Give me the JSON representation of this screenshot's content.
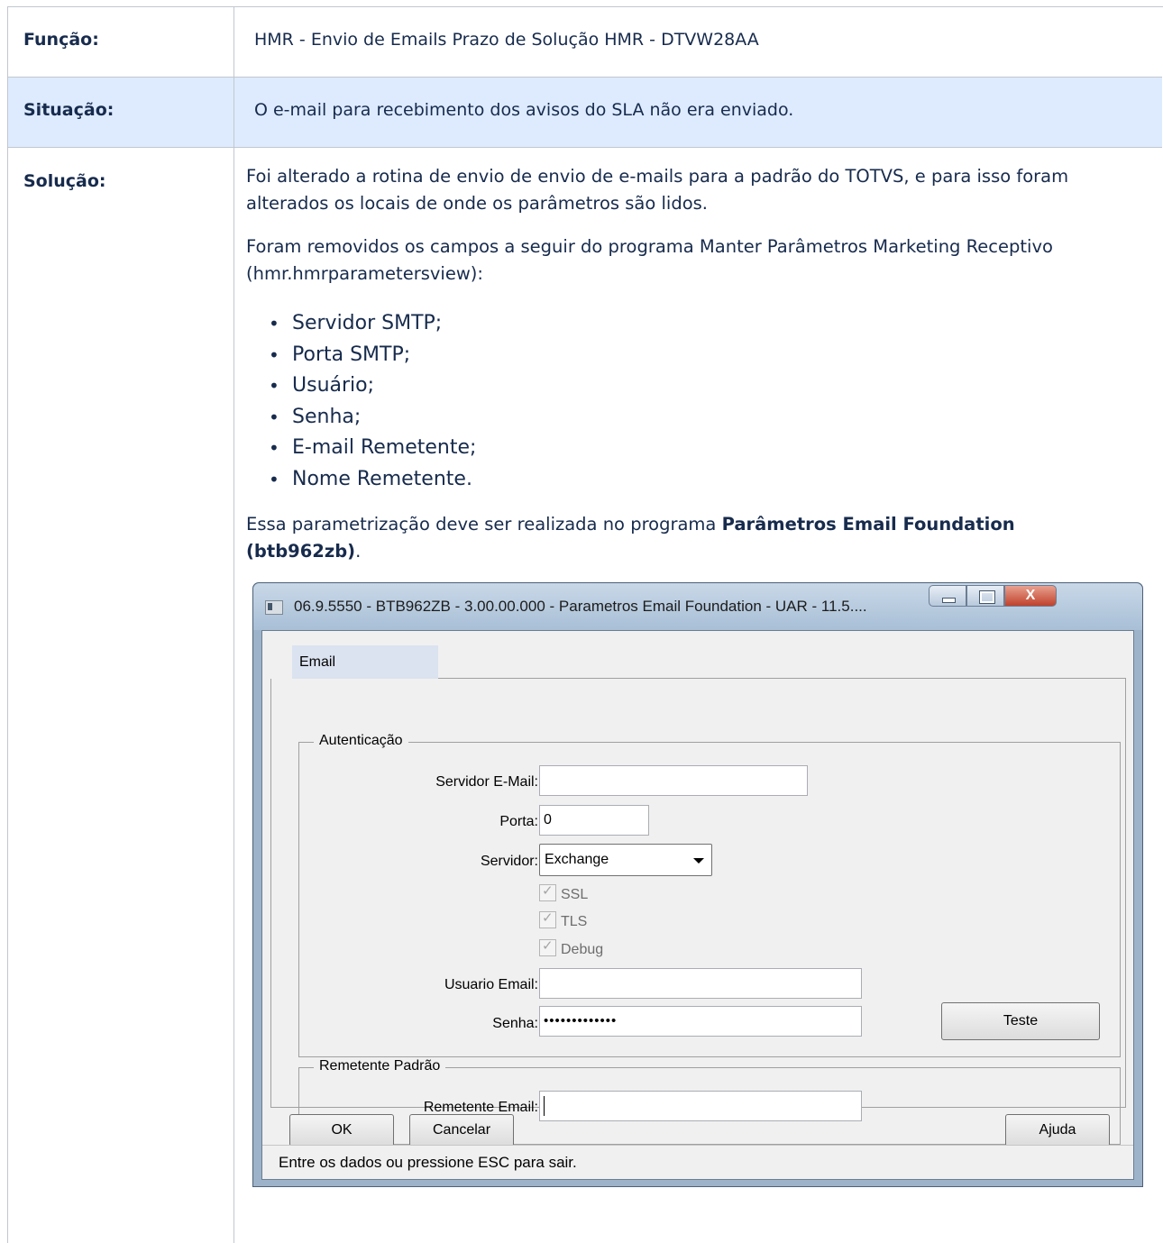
{
  "table": {
    "rows": [
      {
        "header": "Função:",
        "text": "HMR - Envio de Emails Prazo de Solução HMR - DTVW28AA"
      },
      {
        "header": "Situação:",
        "text": "O e-mail para recebimento dos avisos do SLA não era enviado."
      },
      {
        "header": "Solução:"
      }
    ]
  },
  "solution": {
    "p1": "Foi alterado a rotina de envio de envio de e-mails para a padrão do TOTVS, e para isso foram alterados os locais de onde os parâmetros são lidos.",
    "p2": "Foram removidos os campos a seguir do programa Manter Parâmetros Marketing Receptivo (hmr.hmrparametersview):",
    "fields": [
      "Servidor SMTP;",
      "Porta SMTP;",
      "Usuário;",
      "Senha;",
      "E-mail Remetente;",
      "Nome Remetente."
    ],
    "p3_prefix": "Essa parametrização deve ser realizada no programa ",
    "p3_bold": "Parâmetros Email Foundation (btb962zb)",
    "p3_suffix": "."
  },
  "window": {
    "title": "06.9.5550 - BTB962ZB - 3.00.00.000 - Parametros Email Foundation - UAR - 11.5....",
    "close_glyph": "X",
    "tab": "Email",
    "group_auth": "Autenticação",
    "labels": {
      "servidor_email": "Servidor E-Mail:",
      "porta": "Porta:",
      "servidor": "Servidor:",
      "usuario_email": "Usuario Email:",
      "senha": "Senha:",
      "remetente_email": "Remetente Email:"
    },
    "values": {
      "servidor_email": "",
      "porta": "0",
      "servidor": "Exchange",
      "usuario_email": "",
      "senha": "•••••••••••••",
      "remetente_email": ""
    },
    "checkboxes": [
      {
        "label": "SSL",
        "checked": true,
        "disabled": true
      },
      {
        "label": "TLS",
        "checked": true,
        "disabled": true
      },
      {
        "label": "Debug",
        "checked": true,
        "disabled": true
      }
    ],
    "group_rem": "Remetente Padrão",
    "buttons": {
      "teste": "Teste",
      "ok": "OK",
      "cancelar": "Cancelar",
      "ajuda": "Ajuda"
    },
    "status": "Entre os dados ou pressione ESC para sair."
  }
}
